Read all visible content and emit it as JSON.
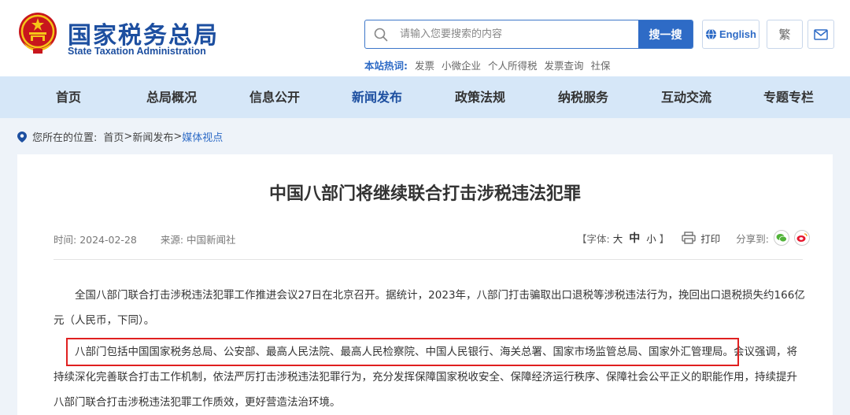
{
  "header": {
    "site_name": "国家税务总局",
    "site_name_en": "State Taxation Administration",
    "search": {
      "placeholder": "请输入您要搜索的内容",
      "button_label": "搜一搜"
    },
    "hotwords": {
      "label": "本站热词:",
      "items": [
        "发票",
        "小微企业",
        "个人所得税",
        "发票查询",
        "社保"
      ]
    },
    "english_label": "English",
    "traditional_label": "繁",
    "accent_color": "#2e6bc6",
    "nav_bg_color": "#d6e7f8"
  },
  "nav": {
    "items": [
      {
        "label": "首页"
      },
      {
        "label": "总局概况"
      },
      {
        "label": "信息公开"
      },
      {
        "label": "新闻发布",
        "active": true
      },
      {
        "label": "政策法规"
      },
      {
        "label": "纳税服务"
      },
      {
        "label": "互动交流"
      },
      {
        "label": "专题专栏"
      }
    ]
  },
  "breadcrumb": {
    "prefix": "您所在的位置:",
    "items": [
      "首页",
      "新闻发布"
    ],
    "current": "媒体视点",
    "separator": ">"
  },
  "article": {
    "title": "中国八部门将继续联合打击涉税违法犯罪",
    "time_label": "时间:",
    "time_value": "2024-02-28",
    "source_label": "来源:",
    "source_value": "中国新闻社",
    "font_size_label": "【字体:",
    "font_size_options": [
      "大",
      "中",
      "小"
    ],
    "font_size_close": "】",
    "print_label": "打印",
    "share_label": "分享到:",
    "share_icons": [
      "wechat-icon",
      "weibo-icon"
    ],
    "paragraphs": [
      "全国八部门联合打击涉税违法犯罪工作推进会议27日在北京召开。据统计，2023年，八部门打击骗取出口退税等涉税违法行为，挽回出口退税损失约166亿元（人民币，下同）。",
      "八部门包括中国国家税务总局、公安部、最高人民法院、最高人民检察院、中国人民银行、海关总署、国家市场监管总局、国家外汇管理局。会议强调，将持续深化完善联合打击工作机制，依法严厉打击涉税违法犯罪行为，充分发挥保障国家税收安全、保障经济运行秩序、保障社会公平正义的职能作用，持续提升八部门联合打击涉税违法犯罪工作质效，更好营造法治环境。"
    ],
    "highlight_color": "#e02020"
  }
}
